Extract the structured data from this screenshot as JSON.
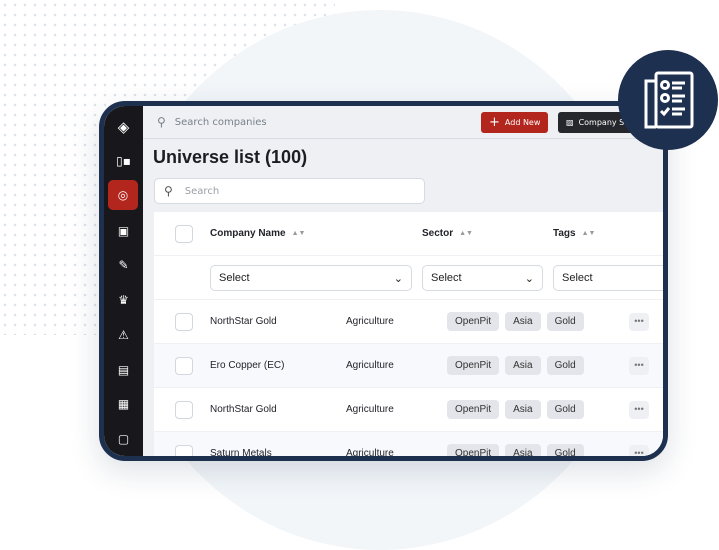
{
  "topbar": {
    "search_placeholder": "Search companies",
    "add_new": "Add New",
    "company_select": "Company S"
  },
  "page": {
    "title": "Universe list (100)",
    "search_placeholder": "Search"
  },
  "table": {
    "headers": {
      "company": "Company Name",
      "sector": "Sector",
      "tags": "Tags"
    },
    "filters": {
      "company": "Select",
      "sector": "Select",
      "tags": "Select"
    },
    "rows": [
      {
        "company": "NorthStar Gold",
        "sector": "Agriculture",
        "tags": [
          "OpenPit",
          "Asia",
          "Gold"
        ]
      },
      {
        "company": "Ero Copper (EC)",
        "sector": "Agriculture",
        "tags": [
          "OpenPit",
          "Asia",
          "Gold"
        ]
      },
      {
        "company": "NorthStar Gold",
        "sector": "Agriculture",
        "tags": [
          "OpenPit",
          "Asia",
          "Gold"
        ]
      },
      {
        "company": "Saturn Metals",
        "sector": "Agriculture",
        "tags": [
          "OpenPit",
          "Asia",
          "Gold"
        ]
      }
    ]
  },
  "colors": {
    "accent": "#b3261e",
    "frame": "#1e3050",
    "sidebar": "#18181c"
  },
  "icons": [
    "logo-icon",
    "dashboard-icon",
    "universe-icon",
    "document-icon",
    "edit-note-icon",
    "alert-bell-icon",
    "warning-icon",
    "file-icon",
    "notes-icon",
    "page-icon",
    "checklist-icon"
  ]
}
